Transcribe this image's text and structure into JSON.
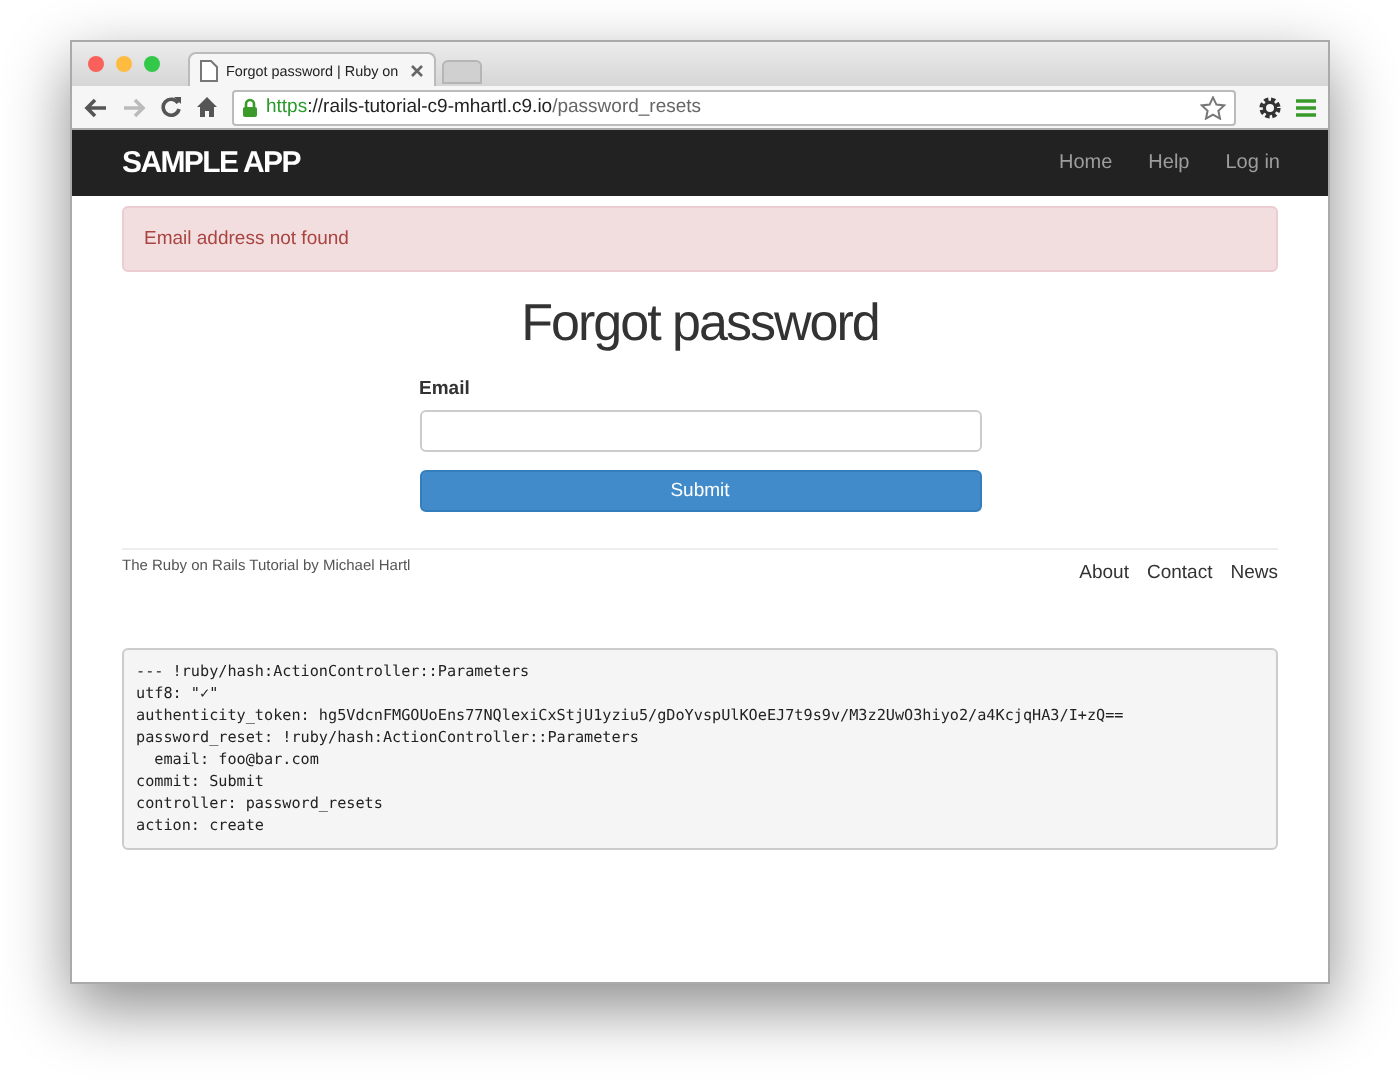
{
  "browser": {
    "tab": {
      "title": "Forgot password | Ruby on",
      "selected": true
    },
    "url": {
      "scheme": "https",
      "host": "://rails-tutorial-c9-mhartl.c9.io",
      "path": "/password_resets"
    }
  },
  "navbar": {
    "logo": "SAMPLE APP",
    "links": [
      "Home",
      "Help",
      "Log in"
    ]
  },
  "alert": {
    "kind": "danger",
    "text": "Email address not found"
  },
  "heading": "Forgot password",
  "form": {
    "label": "Email",
    "button": "Submit"
  },
  "footer": {
    "credit": "The Ruby on Rails Tutorial by Michael Hartl",
    "links": [
      "About",
      "Contact",
      "News"
    ]
  },
  "debug": [
    "--- !ruby/hash:ActionController::Parameters",
    "utf8: \"✓\"",
    "authenticity_token: hg5VdcnFMGOUoEns77NQlexiCxStjU1yziu5/gDoYvspUlKOeEJ7t9s9v/M3z2UwO3hiyo2/a4KcjqHA3/I+zQ==",
    "password_reset: !ruby/hash:ActionController::Parameters",
    "  email: foo@bar.com",
    "commit: Submit",
    "controller: password_resets",
    "action: create"
  ]
}
